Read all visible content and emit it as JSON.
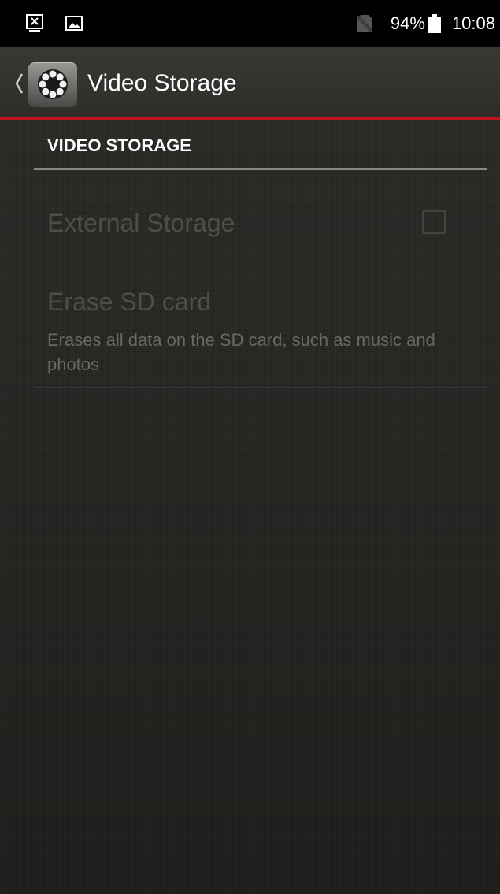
{
  "status_bar": {
    "icons": [
      "screenshot-icon",
      "image-icon",
      "no-sim-icon",
      "battery-icon"
    ],
    "battery_text": "94%",
    "time": "10:08"
  },
  "action_bar": {
    "title": "Video Storage",
    "app_icon": "settings-gear-icon",
    "back_icon": "chevron-left-icon"
  },
  "section": {
    "header": "VIDEO STORAGE"
  },
  "preferences": [
    {
      "title": "External Storage",
      "checked": false,
      "enabled": false
    },
    {
      "title": "Erase SD card",
      "summary": "Erases all data on the SD card, such as music and photos",
      "enabled": false
    }
  ],
  "colors": {
    "accent_line": "#c0141a",
    "status_bar_bg": "#000000",
    "disabled_text": "#4f4d4a"
  }
}
